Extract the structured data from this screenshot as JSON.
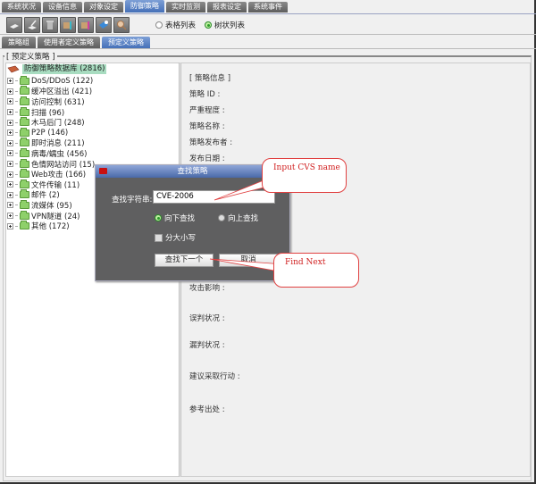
{
  "top_tabs": [
    "系统状况",
    "设备信息",
    "对象设定",
    "防御策略",
    "实时监测",
    "报表设定",
    "系统事件"
  ],
  "active_top_tab": "防御策略",
  "toolbar": {
    "icons": [
      "add-icon",
      "edit-icon",
      "delete-icon",
      "import-icon",
      "export-icon",
      "update-icon",
      "search-icon"
    ]
  },
  "view_options": {
    "table_list": "表格列表",
    "tree_list": "树状列表",
    "selected": "树状列表"
  },
  "sub_tabs": [
    "策略组",
    "使用者定义策略",
    "预定义策略"
  ],
  "active_sub_tab": "预定义策略",
  "group_label": "[ 预定义策略 ]",
  "tree": {
    "root": "防御策略数据库 (2816)",
    "items": [
      "DoS/DDoS (122)",
      "缓冲区溢出 (421)",
      "访问控制 (631)",
      "扫描 (96)",
      "木马后门 (248)",
      "P2P (146)",
      "即时消息 (211)",
      "病毒/蠕虫 (456)",
      "色情网站访问 (15)",
      "Web攻击 (166)",
      "文件传输 (11)",
      "邮件 (2)",
      "流媒体 (95)",
      "VPN隧道 (24)",
      "其他 (172)"
    ]
  },
  "info": {
    "header": "[ 策略信息 ]",
    "fields": [
      "策略 ID :",
      "严重程度 :",
      "策略名称 :",
      "策略发布者 :",
      "发布日期 :",
      "攻击影响 :",
      "误判状况 :",
      "漏判状况 :",
      "建议采取行动 :",
      "参考出处 :"
    ]
  },
  "dialog": {
    "title": "查找策略",
    "label": "查找字符串:",
    "input_value": "CVE-2006",
    "radio_down": "向下查找",
    "radio_up": "向上查找",
    "radio_selected": "向下查找",
    "checkbox": "分大小写",
    "find_next": "查找下一个",
    "cancel": "取消"
  },
  "callouts": {
    "input": "Input CVS name",
    "find": "Find Next"
  }
}
